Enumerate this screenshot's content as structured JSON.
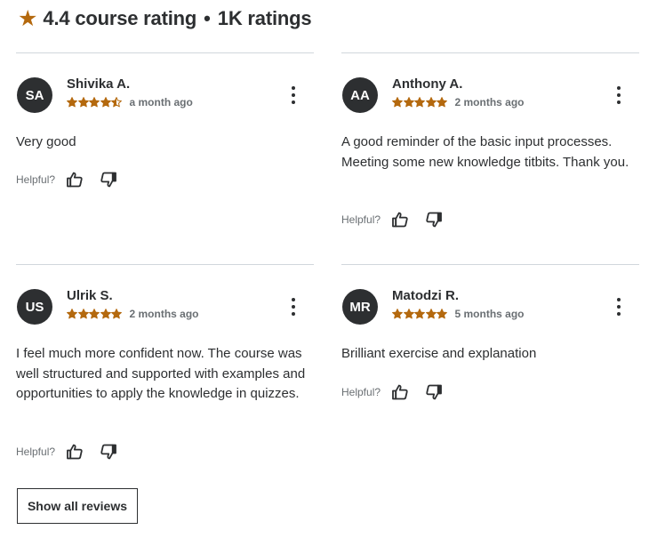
{
  "summary": {
    "rating_text": "4.4 course rating",
    "separator": "•",
    "ratings_count": "1K ratings",
    "star_icon": "star-icon",
    "accent_color": "#b4690e"
  },
  "reviews": [
    {
      "initials": "SA",
      "name": "Shivika A.",
      "rating": 4.5,
      "time": "a month ago",
      "text": "Very good",
      "helpful_label": "Helpful?"
    },
    {
      "initials": "AA",
      "name": "Anthony A.",
      "rating": 5,
      "time": "2 months ago",
      "text": "A good reminder of the basic input processes. Meeting some new knowledge titbits. Thank you.",
      "helpful_label": "Helpful?"
    },
    {
      "initials": "US",
      "name": "Ulrik S.",
      "rating": 5,
      "time": "2 months ago",
      "text": "I feel much more confident now. The course was well structured and supported with examples and opportunities to apply the knowledge in quizzes.",
      "helpful_label": "Helpful?"
    },
    {
      "initials": "MR",
      "name": "Matodzi R.",
      "rating": 5,
      "time": "5 months ago",
      "text": "Brilliant exercise and explanation",
      "helpful_label": "Helpful?"
    }
  ],
  "icons": {
    "more": "more-vertical-icon",
    "thumbs_up": "thumbs-up-icon",
    "thumbs_down": "thumbs-down-icon"
  },
  "show_all_label": "Show all reviews"
}
